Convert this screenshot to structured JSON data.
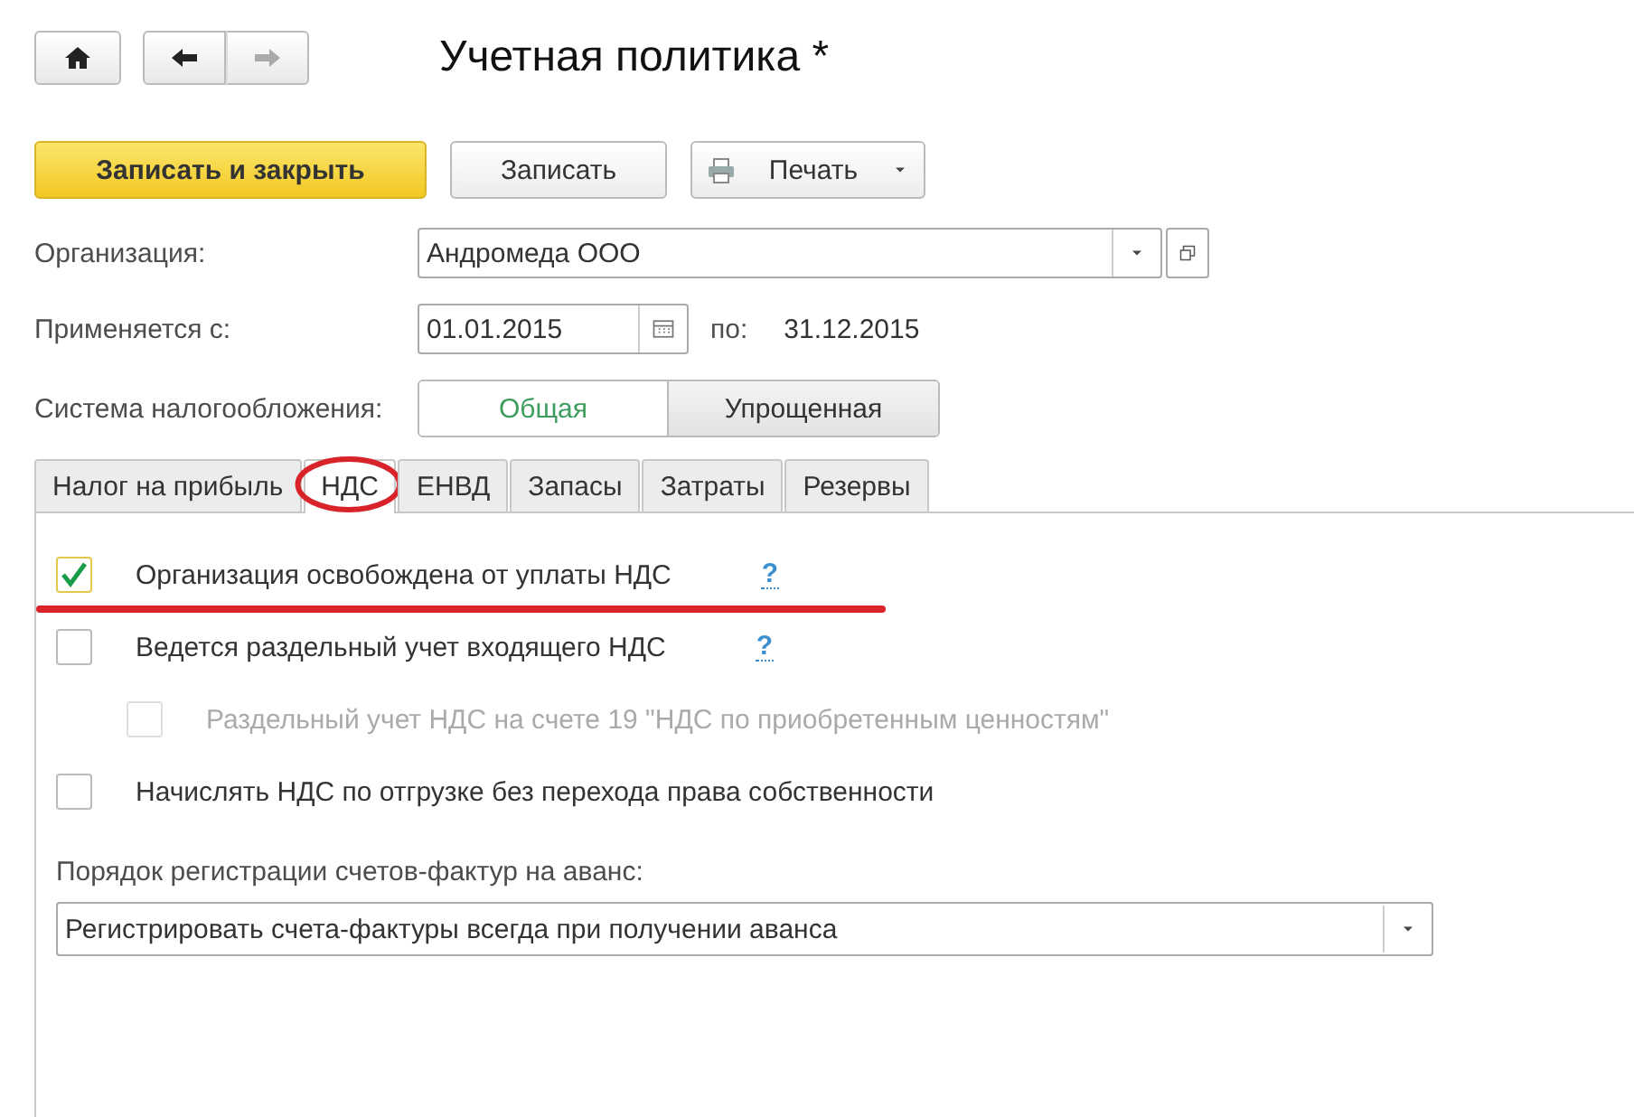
{
  "window": {
    "title": "Учетная политика *"
  },
  "toolbar": [
    {
      "label": "Записать и закрыть",
      "kind": "primary"
    },
    {
      "label": "Записать",
      "kind": "plain"
    },
    {
      "label": "Печать",
      "kind": "menu"
    }
  ],
  "organization": {
    "label": "Организация:",
    "value": "Андромеда ООО"
  },
  "period": {
    "label": "Применяется с:",
    "from": "01.01.2015",
    "to_label": "по:",
    "to": "31.12.2015"
  },
  "tax_system": {
    "label": "Система налогообложения:",
    "options": [
      {
        "label": "Общая",
        "selected": true
      },
      {
        "label": "Упрощенная",
        "selected": false
      }
    ]
  },
  "tabs": [
    {
      "label": "Налог на прибыль",
      "selected": false,
      "circled": false
    },
    {
      "label": "НДС",
      "selected": true,
      "circled": true
    },
    {
      "label": "ЕНВД",
      "selected": false,
      "circled": false
    },
    {
      "label": "Запасы",
      "selected": false,
      "circled": false
    },
    {
      "label": "Затраты",
      "selected": false,
      "circled": false
    },
    {
      "label": "Резервы",
      "selected": false,
      "circled": false
    }
  ],
  "options": [
    {
      "label": "Организация освобождена от уплаты НДС",
      "checked": true,
      "disabled": false,
      "help": "?",
      "underlined": true
    },
    {
      "label": "Ведется раздельный учет входящего НДС",
      "checked": false,
      "disabled": false,
      "help": "?",
      "underlined": false,
      "children": [
        {
          "label": "Раздельный учет НДС на счете 19 \"НДС по приобретенным ценностям\"",
          "checked": false,
          "disabled": true,
          "underlined": false
        }
      ]
    },
    {
      "label": "Начислять НДС по отгрузке без перехода права собственности",
      "checked": false,
      "disabled": false,
      "underlined": false
    }
  ],
  "invoice_order": {
    "label": "Порядок регистрации счетов-фактур на аванс:",
    "value": "Регистрировать счета-фактуры всегда при получении аванса"
  }
}
